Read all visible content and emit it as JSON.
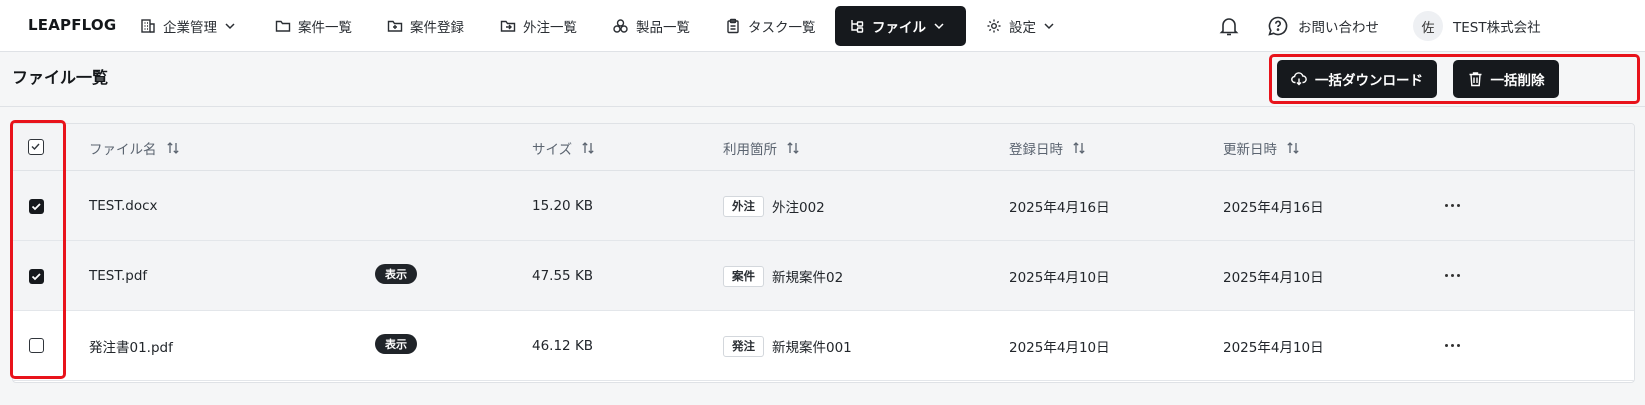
{
  "brand": "LEAPFLOG",
  "nav": {
    "items": [
      {
        "label": "企業管理",
        "icon": "building-icon"
      },
      {
        "label": "案件一覧",
        "icon": "folder-icon"
      },
      {
        "label": "案件登録",
        "icon": "folder-plus-icon"
      },
      {
        "label": "外注一覧",
        "icon": "folder-export-icon"
      },
      {
        "label": "製品一覧",
        "icon": "boxes-icon"
      },
      {
        "label": "タスク一覧",
        "icon": "clipboard-icon"
      },
      {
        "label": "ファイル",
        "icon": "file-tree-icon",
        "active": true
      },
      {
        "label": "設定",
        "icon": "gear-icon"
      }
    ],
    "contact": "お問い合わせ",
    "avatar_initial": "佐",
    "company": "TEST株式会社"
  },
  "page": {
    "title": "ファイル一覧",
    "bulk_download": "一括ダウンロード",
    "bulk_delete": "一括削除"
  },
  "table": {
    "columns": [
      "ファイル名",
      "サイズ",
      "利用箇所",
      "登録日時",
      "更新日時"
    ],
    "rows": [
      {
        "name": "TEST.docx",
        "checked": true,
        "view": "",
        "size": "15.20 KB",
        "usage_tag": "外注",
        "usage": "外注002",
        "created": "2025年4月16日",
        "updated": "2025年4月16日"
      },
      {
        "name": "TEST.pdf",
        "checked": true,
        "view": "表示",
        "size": "47.55 KB",
        "usage_tag": "案件",
        "usage": "新規案件02",
        "created": "2025年4月10日",
        "updated": "2025年4月10日"
      },
      {
        "name": "発注書01.pdf",
        "checked": false,
        "view": "表示",
        "size": "46.12 KB",
        "usage_tag": "発注",
        "usage": "新規案件001",
        "created": "2025年4月10日",
        "updated": "2025年4月10日"
      }
    ]
  },
  "colors": {
    "dark": "#16191d",
    "highlight": "#e8131b",
    "selected_row": "#f3f4f6"
  }
}
